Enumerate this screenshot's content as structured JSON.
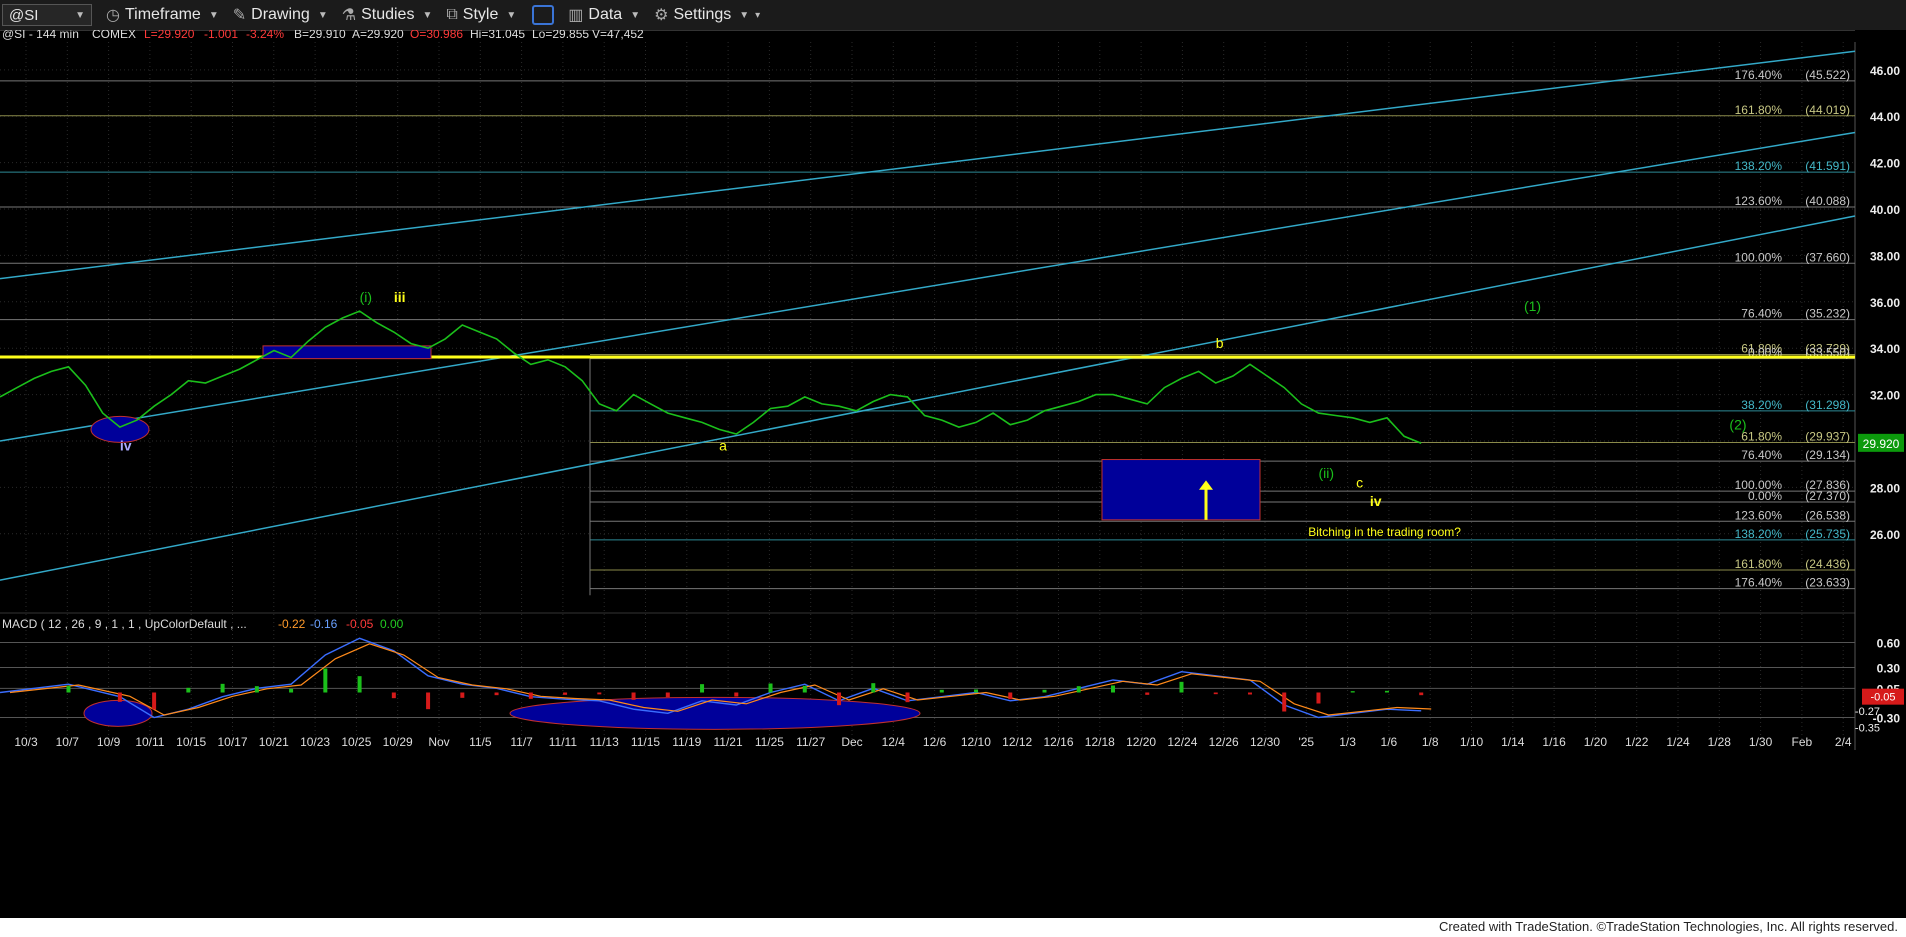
{
  "toolbar": {
    "symbol": "@SI",
    "timeframe": "Timeframe",
    "drawing": "Drawing",
    "studies": "Studies",
    "style": "Style",
    "data": "Data",
    "settings": "Settings"
  },
  "header": {
    "symbol_line": "@SI - 144 min",
    "exchange": "COMEX",
    "last": "L=29.920",
    "change": "-1.001",
    "pct": "-3.24%",
    "bid": "B=29.910",
    "ask": "A=29.920",
    "open": "O=30.986",
    "high": "Hi=31.045",
    "low": "Lo=29.855",
    "volume": "V=47,452"
  },
  "macd_header": {
    "label": "MACD ( 12 , 26 , 9 , 1 , 1 , UpColorDefault , ...",
    "v1": "-0.22",
    "v2": "-0.16",
    "v3": "-0.05",
    "v4": "0.00"
  },
  "footer": "Created with TradeStation. ©TradeStation Technologies, Inc. All rights reserved.",
  "colors": {
    "price": "#1bbf1b",
    "yellow": "#ffff1a",
    "channel": "#33a9c8",
    "fib_line": "#8a8a8a",
    "fib_text": "#c8c8c8",
    "box": "#00009a",
    "last_price_bg": "#0c9a0c",
    "macd_neg_bg": "#d61a1a"
  },
  "chart_data": {
    "type": "line",
    "title": "@SI - 144 min COMEX",
    "y_axis": {
      "range": [
        22.8,
        47.2
      ],
      "ticks": [
        "46.00",
        "44.00",
        "42.00",
        "40.00",
        "38.00",
        "36.00",
        "34.00",
        "32.00",
        "30.00",
        "28.00",
        "26.00"
      ]
    },
    "x_ticks": [
      "10/3",
      "10/7",
      "10/9",
      "10/11",
      "10/15",
      "10/17",
      "10/21",
      "10/23",
      "10/25",
      "10/29",
      "Nov",
      "11/5",
      "11/7",
      "11/11",
      "11/13",
      "11/15",
      "11/19",
      "11/21",
      "11/25",
      "11/27",
      "Dec",
      "12/4",
      "12/6",
      "12/10",
      "12/12",
      "12/16",
      "12/18",
      "12/20",
      "12/24",
      "12/26",
      "12/30",
      "'25",
      "1/3",
      "1/6",
      "1/8",
      "1/10",
      "1/14",
      "1/16",
      "1/20",
      "1/22",
      "1/24",
      "1/28",
      "1/30",
      "Feb",
      "2/4"
    ],
    "series": [
      {
        "name": "@SI",
        "points": [
          [
            0,
            31.9
          ],
          [
            1,
            32.3
          ],
          [
            2,
            32.7
          ],
          [
            3,
            33.0
          ],
          [
            4,
            33.2
          ],
          [
            5,
            32.4
          ],
          [
            6,
            31.2
          ],
          [
            7,
            30.6
          ],
          [
            8,
            30.9
          ],
          [
            9,
            31.5
          ],
          [
            10,
            32.0
          ],
          [
            11,
            32.6
          ],
          [
            12,
            32.5
          ],
          [
            13,
            32.8
          ],
          [
            14,
            33.1
          ],
          [
            15,
            33.5
          ],
          [
            16,
            33.9
          ],
          [
            17,
            33.6
          ],
          [
            18,
            34.3
          ],
          [
            19,
            34.9
          ],
          [
            20,
            35.3
          ],
          [
            21,
            35.6
          ],
          [
            22,
            35.1
          ],
          [
            23,
            34.7
          ],
          [
            24,
            34.2
          ],
          [
            25,
            34.0
          ],
          [
            26,
            34.4
          ],
          [
            27,
            35.0
          ],
          [
            28,
            34.7
          ],
          [
            29,
            34.4
          ],
          [
            30,
            33.8
          ],
          [
            31,
            33.3
          ],
          [
            32,
            33.5
          ],
          [
            33,
            33.2
          ],
          [
            34,
            32.6
          ],
          [
            35,
            31.6
          ],
          [
            36,
            31.3
          ],
          [
            37,
            32.0
          ],
          [
            38,
            31.6
          ],
          [
            39,
            31.2
          ],
          [
            40,
            31.0
          ],
          [
            41,
            30.8
          ],
          [
            42,
            30.5
          ],
          [
            43,
            30.3
          ],
          [
            44,
            30.8
          ],
          [
            45,
            31.4
          ],
          [
            46,
            31.5
          ],
          [
            47,
            31.9
          ],
          [
            48,
            31.6
          ],
          [
            49,
            31.5
          ],
          [
            50,
            31.3
          ],
          [
            51,
            31.7
          ],
          [
            52,
            32.0
          ],
          [
            53,
            31.9
          ],
          [
            54,
            31.1
          ],
          [
            55,
            30.9
          ],
          [
            56,
            30.6
          ],
          [
            57,
            30.8
          ],
          [
            58,
            31.2
          ],
          [
            59,
            30.7
          ],
          [
            60,
            30.9
          ],
          [
            61,
            31.3
          ],
          [
            62,
            31.5
          ],
          [
            63,
            31.7
          ],
          [
            64,
            32.0
          ],
          [
            65,
            32.0
          ],
          [
            66,
            31.8
          ],
          [
            67,
            31.6
          ],
          [
            68,
            32.3
          ],
          [
            69,
            32.7
          ],
          [
            70,
            33.0
          ],
          [
            71,
            32.5
          ],
          [
            72,
            32.8
          ],
          [
            73,
            33.3
          ],
          [
            74,
            32.8
          ],
          [
            75,
            32.3
          ],
          [
            76,
            31.6
          ],
          [
            77,
            31.2
          ],
          [
            78,
            31.1
          ],
          [
            79,
            31.0
          ],
          [
            80,
            30.8
          ],
          [
            81,
            31.0
          ],
          [
            82,
            30.2
          ],
          [
            83,
            29.9
          ]
        ]
      },
      {
        "name": "MACD",
        "points": [
          [
            0,
            0.0
          ],
          [
            4,
            0.1
          ],
          [
            7,
            -0.05
          ],
          [
            9,
            -0.3
          ],
          [
            11,
            -0.2
          ],
          [
            13,
            -0.05
          ],
          [
            15,
            0.05
          ],
          [
            17,
            0.1
          ],
          [
            19,
            0.45
          ],
          [
            21,
            0.65
          ],
          [
            23,
            0.5
          ],
          [
            25,
            0.2
          ],
          [
            27,
            0.1
          ],
          [
            29,
            0.05
          ],
          [
            31,
            -0.05
          ],
          [
            33,
            -0.08
          ],
          [
            35,
            -0.1
          ],
          [
            37,
            -0.2
          ],
          [
            39,
            -0.25
          ],
          [
            41,
            -0.1
          ],
          [
            43,
            -0.15
          ],
          [
            45,
            0.0
          ],
          [
            47,
            0.1
          ],
          [
            49,
            -0.1
          ],
          [
            51,
            0.05
          ],
          [
            53,
            -0.1
          ],
          [
            55,
            -0.05
          ],
          [
            57,
            0.0
          ],
          [
            59,
            -0.1
          ],
          [
            61,
            -0.05
          ],
          [
            63,
            0.05
          ],
          [
            65,
            0.15
          ],
          [
            67,
            0.1
          ],
          [
            69,
            0.25
          ],
          [
            71,
            0.2
          ],
          [
            73,
            0.15
          ],
          [
            75,
            -0.15
          ],
          [
            77,
            -0.3
          ],
          [
            79,
            -0.25
          ],
          [
            81,
            -0.2
          ],
          [
            83,
            -0.22
          ]
        ]
      }
    ],
    "fib_levels": [
      {
        "label": "176.40%",
        "value": "(45.522)",
        "y": 45.522,
        "color": "#c8c8c8"
      },
      {
        "label": "161.80%",
        "value": "(44.019)",
        "y": 44.019,
        "color": "#c8c884"
      },
      {
        "label": "138.20%",
        "value": "(41.591)",
        "y": 41.591,
        "color": "#44b8c8"
      },
      {
        "label": "123.60%",
        "value": "(40.088)",
        "y": 40.088,
        "color": "#c8c8c8"
      },
      {
        "label": "100.00%",
        "value": "(37.660)",
        "y": 37.66,
        "color": "#c8c8c8"
      },
      {
        "label": "76.40%",
        "value": "(35.232)",
        "y": 35.232,
        "color": "#c8c8c8"
      },
      {
        "label": "61.80%",
        "value": "(33.729)",
        "y": 33.729,
        "color": "#c8c884"
      },
      {
        "label": "0.00%",
        "value": "(33.550)",
        "y": 33.55,
        "color": "#c8c8c8"
      },
      {
        "label": "38.20%",
        "value": "(31.298)",
        "y": 31.298,
        "color": "#44b8c8"
      },
      {
        "label": "61.80%",
        "value": "(29.937)",
        "y": 29.937,
        "color": "#c8c884"
      },
      {
        "label": "76.40%",
        "value": "(29.134)",
        "y": 29.134,
        "color": "#c8c8c8"
      },
      {
        "label": "100.00%",
        "value": "(27.836)",
        "y": 27.836,
        "color": "#c8c8c8"
      },
      {
        "label": "0.00%",
        "value": "(27.370)",
        "y": 27.37,
        "color": "#c8c8c8"
      },
      {
        "label": "123.60%",
        "value": "(26.538)",
        "y": 26.538,
        "color": "#c8c8c8"
      },
      {
        "label": "138.20%",
        "value": "(25.735)",
        "y": 25.735,
        "color": "#44b8c8"
      },
      {
        "label": "161.80%",
        "value": "(24.436)",
        "y": 24.436,
        "color": "#c8c884"
      },
      {
        "label": "176.40%",
        "value": "(23.633)",
        "y": 23.633,
        "color": "#c8c8c8"
      }
    ],
    "annotations": [
      {
        "text": "(i)",
        "x": 21,
        "y": 36.0,
        "color": "#1bbf1b"
      },
      {
        "text": "iii",
        "x": 23,
        "y": 36.0,
        "color": "#ffff1a"
      },
      {
        "text": "iv",
        "x": 7,
        "y": 29.6,
        "color": "#aaaaff"
      },
      {
        "text": "a",
        "x": 42,
        "y": 29.6,
        "color": "#ffff1a"
      },
      {
        "text": "b",
        "x": 71,
        "y": 34.0,
        "color": "#ffff1a"
      },
      {
        "text": "(1)",
        "x": 89,
        "y": 35.6,
        "color": "#1bbf1b"
      },
      {
        "text": "(2)",
        "x": 101,
        "y": 30.5,
        "color": "#1bbf1b"
      },
      {
        "text": "(ii)",
        "x": 77,
        "y": 28.4,
        "color": "#1bbf1b"
      },
      {
        "text": "c",
        "x": 79.2,
        "y": 28.0,
        "color": "#ffff1a"
      },
      {
        "text": "iv",
        "x": 80,
        "y": 27.2,
        "color": "#ffff1a"
      },
      {
        "text": "Bitching in the trading room?",
        "x": 76.4,
        "y": 25.9,
        "color": "#ffff1a"
      }
    ],
    "last_price": "29.920",
    "macd_axis": {
      "range": [
        -0.45,
        0.75
      ],
      "ticks": [
        "0.60",
        "0.30",
        "0.05",
        "-0.30"
      ],
      "lines": [
        "-0.27",
        "-0.35"
      ],
      "current": "-0.05"
    }
  }
}
